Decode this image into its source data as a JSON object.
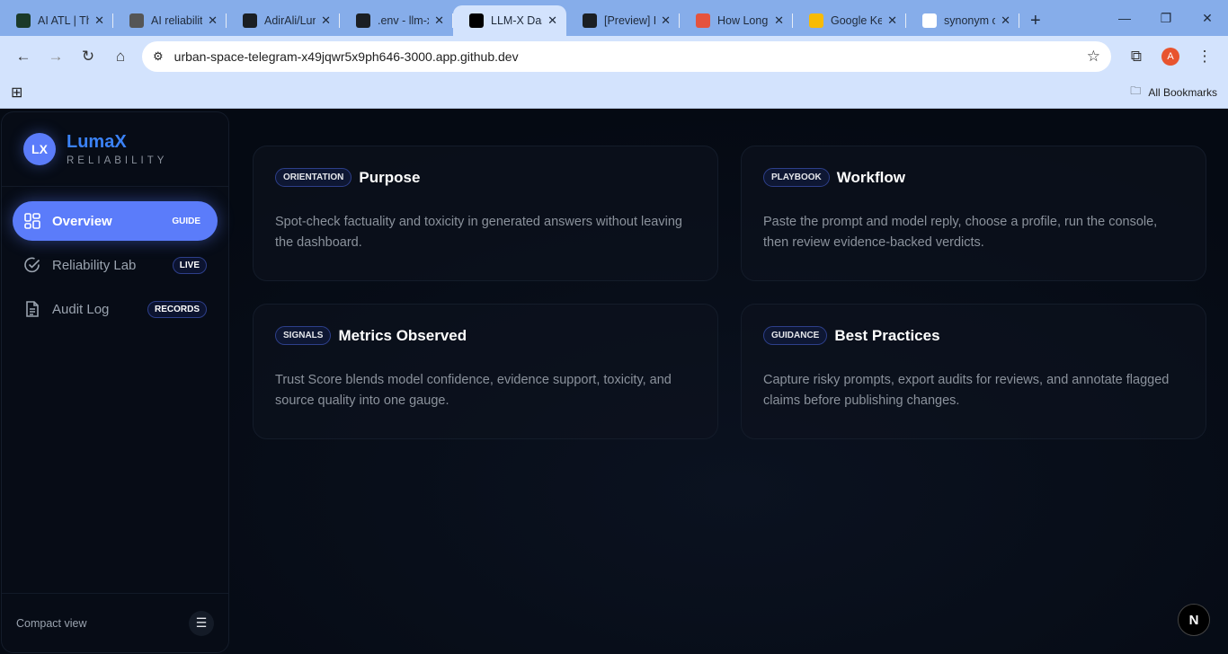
{
  "browser": {
    "tabs": [
      {
        "title": "AI ATL | The",
        "icon": "aiatl-icon",
        "color": "#1b3a2a"
      },
      {
        "title": "AI reliability",
        "icon": "openai-icon",
        "color": "#555"
      },
      {
        "title": "AdirAli/LumaX",
        "icon": "github-icon",
        "color": "#1b1f24"
      },
      {
        "title": ".env - llm-x",
        "icon": "github-icon",
        "color": "#1b1f24"
      },
      {
        "title": "LLM-X Dashboard",
        "icon": "v0-icon",
        "color": "#000"
      },
      {
        "title": "[Preview] README",
        "icon": "github-icon",
        "color": "#1b1f24"
      },
      {
        "title": "How Long",
        "icon": "calculator-icon",
        "color": "#e5533d"
      },
      {
        "title": "Google Keep",
        "icon": "keep-icon",
        "color": "#f8bb04"
      },
      {
        "title": "synonym of",
        "icon": "google-icon",
        "color": "#fff"
      }
    ],
    "url": "urban-space-telegram-x49jqwr5x9ph646-3000.app.github.dev",
    "profile_initial": "A",
    "all_bookmarks": "All Bookmarks"
  },
  "sidebar": {
    "logo": "LX",
    "brand": "LumaX",
    "subtitle": "RELIABILITY",
    "items": [
      {
        "label": "Overview",
        "badge": "GUIDE"
      },
      {
        "label": "Reliability Lab",
        "badge": "LIVE"
      },
      {
        "label": "Audit Log",
        "badge": "RECORDS"
      }
    ],
    "footer": "Compact view"
  },
  "cards": [
    {
      "tag": "ORIENTATION",
      "title": "Purpose",
      "body": "Spot-check factuality and toxicity in generated answers without leaving the dashboard."
    },
    {
      "tag": "PLAYBOOK",
      "title": "Workflow",
      "body": "Paste the prompt and model reply, choose a profile, run the console, then review evidence-backed verdicts."
    },
    {
      "tag": "SIGNALS",
      "title": "Metrics Observed",
      "body": "Trust Score blends model confidence, evidence support, toxicity, and source quality into one gauge."
    },
    {
      "tag": "GUIDANCE",
      "title": "Best Practices",
      "body": "Capture risky prompts, export audits for reviews, and annotate flagged claims before publishing changes."
    }
  ],
  "next_badge": "N"
}
